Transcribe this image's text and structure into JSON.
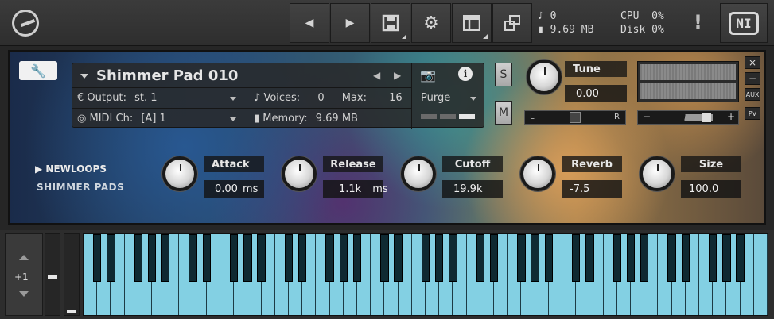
{
  "toolbar": {
    "prev_label": "◀",
    "next_label": "▶",
    "voices": "0",
    "memory": "9.69 MB",
    "cpu_label": "CPU",
    "cpu_value": "0%",
    "disk_label": "Disk",
    "disk_value": "0%",
    "warning": "!",
    "ni_logo": "NI"
  },
  "instrument": {
    "name": "Shimmer Pad 010",
    "output_label": "Output:",
    "output_value": "st. 1",
    "voices_label": "Voices:",
    "voices_value": "0",
    "max_label": "Max:",
    "max_value": "16",
    "purge_label": "Purge",
    "midi_label": "MIDI Ch:",
    "midi_value": "[A]  1",
    "memory_label": "Memory:",
    "memory_value": "9.69 MB",
    "solo": "S",
    "mute": "M",
    "tune_label": "Tune",
    "tune_value": "0.00",
    "pan_left": "L",
    "pan_right": "R",
    "vol_minus": "−",
    "vol_plus": "+",
    "side_close": "×",
    "side_min": "−",
    "side_aux": "AUX",
    "side_pv": "PV"
  },
  "brand": {
    "line1": "NEWLOOPS",
    "line2": "SHIMMER PADS"
  },
  "controls": [
    {
      "label": "Attack",
      "value": "0.00",
      "unit": "ms"
    },
    {
      "label": "Release",
      "value": "1.1k",
      "unit": "ms"
    },
    {
      "label": "Cutoff",
      "value": "19.9k",
      "unit": ""
    },
    {
      "label": "Reverb",
      "value": "-7.5",
      "unit": ""
    },
    {
      "label": "Size",
      "value": "100.0",
      "unit": ""
    }
  ],
  "keyboard": {
    "octave": "+1",
    "key_color": "#83d0e3",
    "black_key_color": "#0f2a32"
  }
}
